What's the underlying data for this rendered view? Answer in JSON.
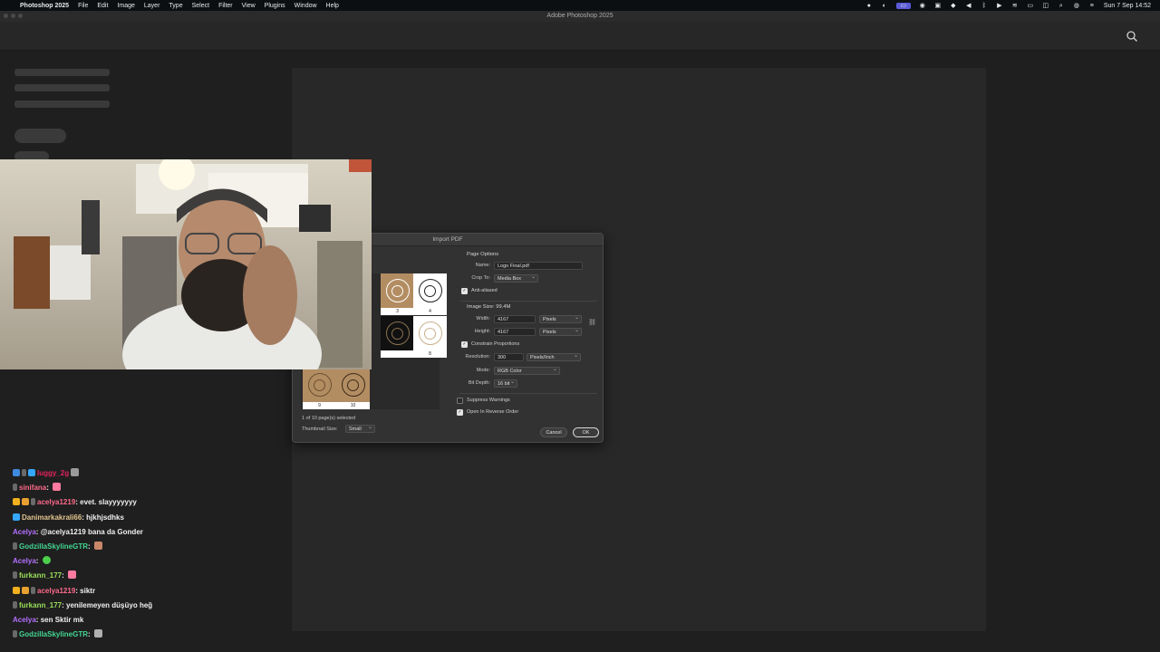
{
  "menubar": {
    "app_name": "Photoshop 2025",
    "items": [
      "File",
      "Edit",
      "Image",
      "Layer",
      "Type",
      "Select",
      "Filter",
      "View",
      "Plugins",
      "Window",
      "Help"
    ],
    "clock": "Sun 7 Sep  14:52"
  },
  "window": {
    "title": "Adobe Photoshop 2025"
  },
  "dialog": {
    "title": "Import PDF",
    "page_options": "Page Options",
    "name_label": "Name:",
    "name_value": "Logo Final.pdf",
    "crop_label": "Crop To:",
    "crop_value": "Media Box",
    "anti_aliased": "Anti-aliased",
    "image_size": "Image Size: 99.4M",
    "width_label": "Width:",
    "width_value": "4167",
    "width_unit": "Pixels",
    "height_label": "Height:",
    "height_value": "4167",
    "height_unit": "Pixels",
    "constrain": "Constrain Proportions",
    "resolution_label": "Resolution:",
    "resolution_value": "300",
    "resolution_unit": "Pixels/Inch",
    "mode_label": "Mode:",
    "mode_value": "RGB Color",
    "bitdepth_label": "Bit Depth:",
    "bitdepth_value": "16 bit",
    "suppress": "Suppress Warnings",
    "reverse": "Open In Reverse Order",
    "cancel": "Cancel",
    "ok": "OK",
    "selection_info": "1 of 10 page(s) selected",
    "thumb_size_label": "Thumbnail Size:",
    "thumb_size_value": "Small",
    "thumbs": [
      "3",
      "4",
      "8",
      "9",
      "10"
    ]
  },
  "chat": [
    {
      "user": "luggy_2g",
      "text": "",
      "color": "#e0245e"
    },
    {
      "user": "sinifana",
      "text": "",
      "color": "#ff6a8b"
    },
    {
      "user": "acelya1219",
      "text": "evet. slayyyyyyy",
      "color": "#ff6a8b"
    },
    {
      "user": "Danimarkakrali66",
      "text": "hjkhjsdhks",
      "color": "#e2c48e"
    },
    {
      "user": "Acelya",
      "text": "@acelya1219 bana da Gonder",
      "color": "#b470ff"
    },
    {
      "user": "GodzillaSkylineGTR",
      "text": "",
      "color": "#42d693"
    },
    {
      "user": "Acelya",
      "text": "",
      "color": "#b470ff"
    },
    {
      "user": "furkann_177",
      "text": "",
      "color": "#9ce05a"
    },
    {
      "user": "acelya1219",
      "text": "siktr",
      "color": "#ff6a8b"
    },
    {
      "user": "furkann_177",
      "text": "yenilemeyen düşüyo heğ",
      "color": "#9ce05a"
    },
    {
      "user": "Acelya",
      "text": "sen Sktir mk",
      "color": "#b470ff"
    },
    {
      "user": "GodzillaSkylineGTR",
      "text": "",
      "color": "#42d693"
    }
  ]
}
